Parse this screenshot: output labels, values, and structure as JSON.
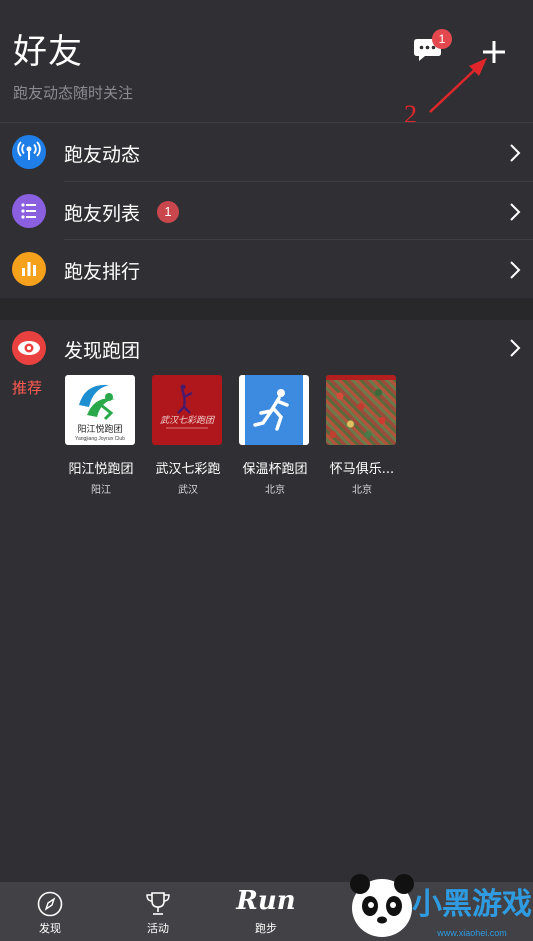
{
  "header": {
    "title": "好友",
    "subtitle": "跑友动态随时关注",
    "message_badge": "1",
    "icons": [
      "message-icon",
      "plus-icon"
    ]
  },
  "annotation": {
    "number": "2",
    "color": "#e0262b"
  },
  "menu": [
    {
      "label": "跑友动态",
      "icon": "signal-icon",
      "color": "#1f7ee8"
    },
    {
      "label": "跑友列表",
      "icon": "list-icon",
      "color": "#8a5fe0",
      "badge": "1"
    },
    {
      "label": "跑友排行",
      "icon": "bar-chart-icon",
      "color": "#f6a11c"
    }
  ],
  "discover": {
    "label": "发现跑团",
    "icon": "eye-icon",
    "color": "#e8413f",
    "recommend_label": "推荐",
    "clubs": [
      {
        "name": "阳江悦跑团",
        "city": "阳江",
        "logo_text": "阳江悦跑团",
        "logo_sub": "Yangjiang Joyrun Club"
      },
      {
        "name": "武汉七彩跑",
        "city": "武汉",
        "logo_text": "武汉七彩跑团"
      },
      {
        "name": "保温杯跑团",
        "city": "北京"
      },
      {
        "name": "怀马俱乐...",
        "city": "北京"
      }
    ]
  },
  "tabbar": {
    "tabs": [
      {
        "label": "发现",
        "icon": "compass-icon"
      },
      {
        "label": "活动",
        "icon": "trophy-icon"
      },
      {
        "label": "跑步",
        "icon": "run-logo",
        "logo_text": "Run"
      }
    ]
  },
  "watermark": {
    "text": "小黑游戏",
    "url": "www.xiaohei.com"
  }
}
